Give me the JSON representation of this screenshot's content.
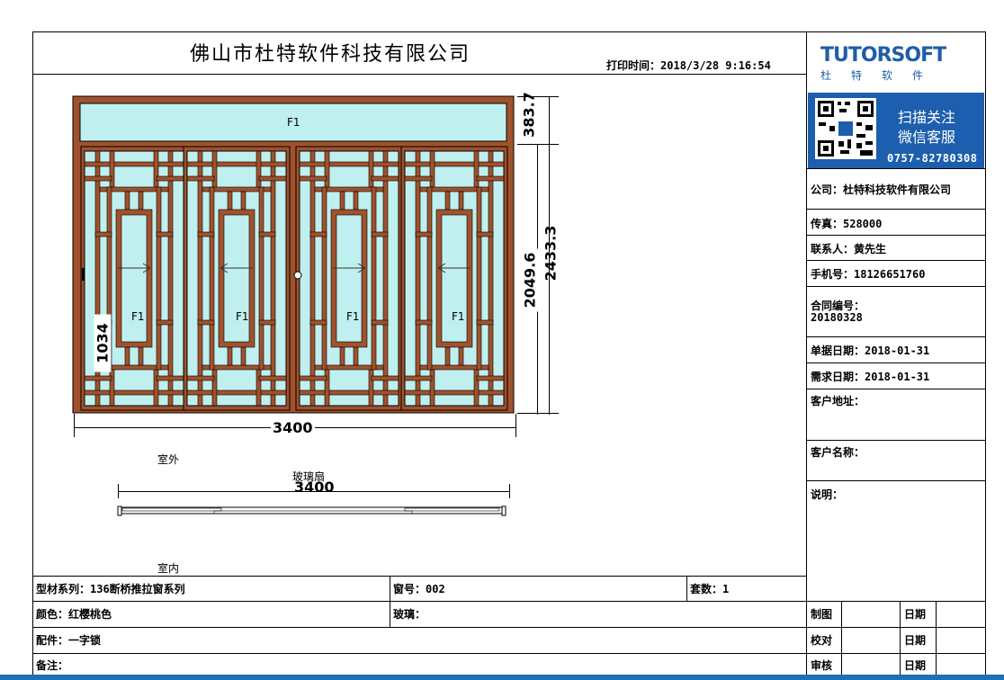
{
  "header": {
    "company_title": "佛山市杜特软件科技有限公司",
    "print_time_label": "打印时间：",
    "print_time_value": "2018/3/28 9:16:54"
  },
  "logo": {
    "brand": "TUTORSOFT",
    "brand_sub": "杜特软件",
    "qr_line1": "扫描关注",
    "qr_line2": "微信客服",
    "phone": "0757-82780308"
  },
  "info": {
    "company": "公司：杜特科技软件有限公司",
    "fax": "传真：528000",
    "contact": "联系人：黄先生",
    "mobile": "手机号：18126651760",
    "contract_label": "合同编号：",
    "contract_value": "20180328",
    "doc_date": "单据日期：2018-01-31",
    "need_date": "需求日期：2018-01-31",
    "customer_address": "客户地址：",
    "customer_name": "客户名称：",
    "remarks": "说明："
  },
  "drawing": {
    "transom_label": "F1",
    "panel_labels": [
      "F1",
      "F1",
      "F1",
      "F1"
    ],
    "dim_width": "3400",
    "dim_top": "383.7",
    "dim_total": "2433.3",
    "dim_sash": "2049.6",
    "dim_handle": "1034",
    "outside_label": "室外",
    "inside_label": "室内",
    "section_label": "玻璃扇",
    "section_width": "3400",
    "frame_color": "#a0522d",
    "glass_color": "#bff0ef"
  },
  "table": {
    "series": "型材系列：136断桥推拉窗系列",
    "window_no": "窗号：002",
    "sets": "套数：1",
    "color": "颜色：红樱桃色",
    "glass": "玻璃：",
    "accessory": "配件：一字锁",
    "note": "备注：",
    "drawn": "制图",
    "checked": "校对",
    "audited": "审核",
    "date1": "日期",
    "date2": "日期",
    "date3": "日期"
  }
}
